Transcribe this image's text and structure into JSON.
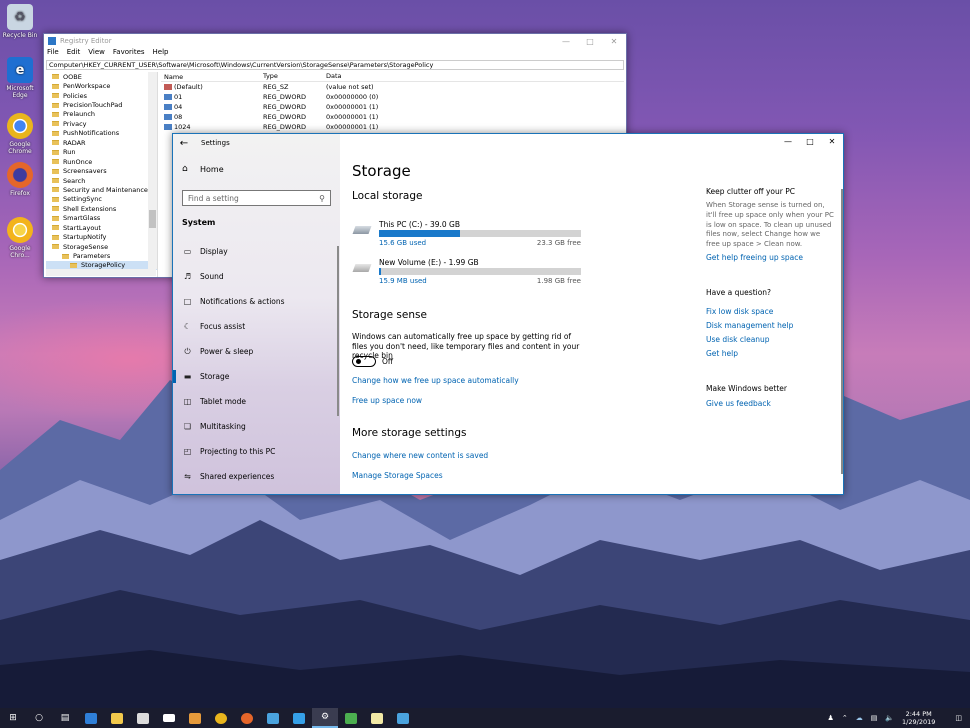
{
  "desktop": {
    "icons": [
      {
        "label": "Recycle Bin",
        "icon": "recycle-bin-icon",
        "color": "#c9d6e2"
      },
      {
        "label": "Microsoft Edge",
        "icon": "edge-icon",
        "color": "#1f6fd1"
      },
      {
        "label": "Google Chrome",
        "icon": "chrome-icon",
        "color": "#e9b51d"
      },
      {
        "label": "Firefox",
        "icon": "firefox-icon",
        "color": "#e5662a"
      },
      {
        "label": "Google Chro...",
        "icon": "chrome-canary-icon",
        "color": "#f3b31c"
      }
    ]
  },
  "registry": {
    "title": "Registry Editor",
    "menu": [
      "File",
      "Edit",
      "View",
      "Favorites",
      "Help"
    ],
    "address": "Computer\\HKEY_CURRENT_USER\\Software\\Microsoft\\Windows\\CurrentVersion\\StorageSense\\Parameters\\StoragePolicy",
    "tree": [
      "OOBE",
      "PenWorkspace",
      "Policies",
      "PrecisionTouchPad",
      "Prelaunch",
      "Privacy",
      "PushNotifications",
      "RADAR",
      "Run",
      "RunOnce",
      "Screensavers",
      "Search",
      "Security and Maintenance",
      "SettingSync",
      "Shell Extensions",
      "SmartGlass",
      "StartLayout",
      "StartupNotify",
      "StorageSense",
      "Parameters",
      "StoragePolicy"
    ],
    "columns": {
      "name": "Name",
      "type": "Type",
      "data": "Data"
    },
    "values": [
      {
        "name": "(Default)",
        "type": "REG_SZ",
        "data": "(value not set)"
      },
      {
        "name": "01",
        "type": "REG_DWORD",
        "data": "0x00000000 (0)"
      },
      {
        "name": "04",
        "type": "REG_DWORD",
        "data": "0x00000001 (1)"
      },
      {
        "name": "08",
        "type": "REG_DWORD",
        "data": "0x00000001 (1)"
      },
      {
        "name": "1024",
        "type": "REG_DWORD",
        "data": "0x00000001 (1)"
      }
    ]
  },
  "settings": {
    "title": "Settings",
    "home": "Home",
    "search_placeholder": "Find a setting",
    "section": "System",
    "nav": [
      {
        "label": "Display",
        "icon": "display-icon"
      },
      {
        "label": "Sound",
        "icon": "sound-icon"
      },
      {
        "label": "Notifications & actions",
        "icon": "notifications-icon"
      },
      {
        "label": "Focus assist",
        "icon": "focus-assist-icon"
      },
      {
        "label": "Power & sleep",
        "icon": "power-icon"
      },
      {
        "label": "Storage",
        "icon": "storage-icon",
        "active": true
      },
      {
        "label": "Tablet mode",
        "icon": "tablet-icon"
      },
      {
        "label": "Multitasking",
        "icon": "multitasking-icon"
      },
      {
        "label": "Projecting to this PC",
        "icon": "projecting-icon"
      },
      {
        "label": "Shared experiences",
        "icon": "shared-icon"
      }
    ],
    "page_title": "Storage",
    "local_storage": "Local storage",
    "drives": [
      {
        "name": "This PC (C:) - 39.0 GB",
        "used": "15.6 GB used",
        "free": "23.3 GB free",
        "used_fraction": 0.4
      },
      {
        "name": "New Volume (E:) - 1.99 GB",
        "used": "15.9 MB used",
        "free": "1.98 GB free",
        "used_fraction": 0.008
      }
    ],
    "storage_sense": "Storage sense",
    "storage_sense_desc": "Windows can automatically free up space by getting rid of files you don't need, like temporary files and content in your recycle bin",
    "toggle_state": "Off",
    "link_change_free": "Change how we free up space automatically",
    "link_free_now": "Free up space now",
    "more_settings": "More storage settings",
    "link_change_location": "Change where new content is saved",
    "link_manage_spaces": "Manage Storage Spaces",
    "side": {
      "clutter_title": "Keep clutter off your PC",
      "clutter_desc": "When Storage sense is turned on, it'll free up space only when your PC is low on space. To clean up unused files now, select Change how we free up space > Clean now.",
      "clutter_link": "Get help freeing up space",
      "question_title": "Have a question?",
      "question_links": [
        "Fix low disk space",
        "Disk management help",
        "Use disk cleanup",
        "Get help"
      ],
      "better_title": "Make Windows better",
      "feedback_link": "Give us feedback"
    }
  },
  "taskbar": {
    "time": "2:44 PM",
    "date": "1/29/2019",
    "items": [
      {
        "icon": "start-icon",
        "color": "#ffffff"
      },
      {
        "icon": "cortana-icon",
        "color": "#ffffff"
      },
      {
        "icon": "task-view-icon",
        "color": "#ffffff"
      },
      {
        "icon": "edge-icon",
        "color": "#2f7fd8"
      },
      {
        "icon": "file-explorer-icon",
        "color": "#f2c94c"
      },
      {
        "icon": "store-icon",
        "color": "#dcdcdc"
      },
      {
        "icon": "mail-icon",
        "color": "#ffffff"
      },
      {
        "icon": "winamp-icon",
        "color": "#e59a3b"
      },
      {
        "icon": "chrome-icon",
        "color": "#e9b51d"
      },
      {
        "icon": "firefox-icon",
        "color": "#e5662a"
      },
      {
        "icon": "remote-desktop-icon",
        "color": "#4aa3df"
      },
      {
        "icon": "visual-studio-code-icon",
        "color": "#35a0e8"
      },
      {
        "icon": "settings-icon",
        "color": "#ffffff",
        "active": true
      },
      {
        "icon": "photos-icon",
        "color": "#4caf50"
      },
      {
        "icon": "notepad-icon",
        "color": "#f2e9a6"
      },
      {
        "icon": "visual-studio-icon",
        "color": "#4aa3df"
      }
    ]
  }
}
